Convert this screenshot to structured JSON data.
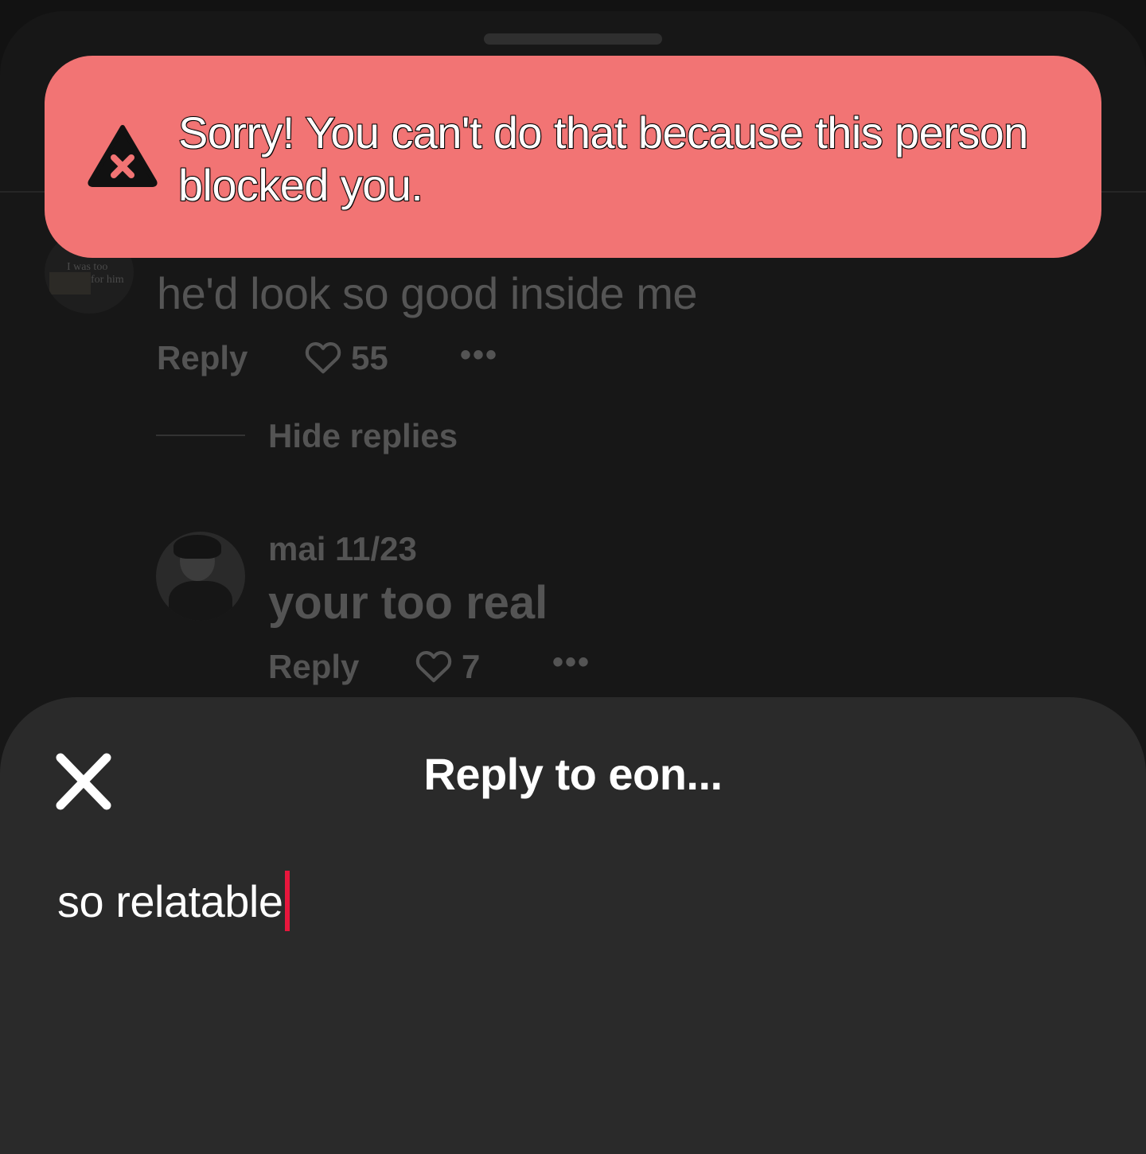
{
  "toast": {
    "message": "Sorry! You can't do that because this person blocked you.",
    "icon": "warning-x-icon",
    "color": "#f27474"
  },
  "comments": [
    {
      "avatar_text_line1": "I was too",
      "avatar_text_line2": "for him",
      "text": "he'd look so good inside me",
      "reply_label": "Reply",
      "likes": "55",
      "more": "•••"
    }
  ],
  "thread": {
    "hide_replies_label": "Hide replies"
  },
  "replies": [
    {
      "author_meta": "mai 11/23",
      "text": "your too real",
      "reply_label": "Reply",
      "likes": "7",
      "more": "•••"
    }
  ],
  "composer": {
    "title": "Reply to eon...",
    "input_value": "so relatable",
    "caret_color": "#e8163c"
  }
}
